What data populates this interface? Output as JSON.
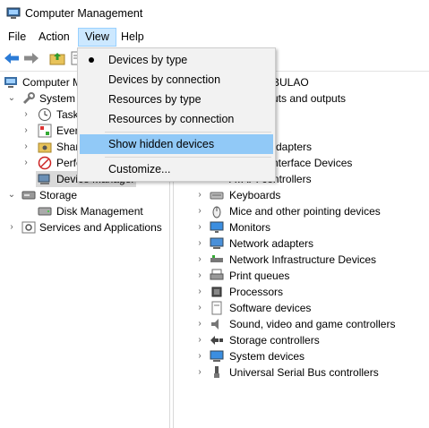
{
  "window": {
    "title": "Computer Management"
  },
  "menubar": {
    "file": "File",
    "action": "Action",
    "view": "View",
    "help": "Help"
  },
  "view_menu": {
    "items": [
      {
        "label": "Devices by type",
        "checked": true
      },
      {
        "label": "Devices by connection"
      },
      {
        "label": "Resources by type"
      },
      {
        "label": "Resources by connection"
      },
      {
        "label": "Show hidden devices",
        "highlighted": true
      },
      {
        "label": "Customize..."
      }
    ]
  },
  "left_tree": {
    "root": "Computer M",
    "system_tools": "System T",
    "task": "Task",
    "event": "Ever",
    "shared": "Shar",
    "perf": "Perfo",
    "device_manager": "Device Manager",
    "storage": "Storage",
    "disk_mgmt": "Disk Management",
    "services": "Services and Applications"
  },
  "device_tree": {
    "computer_partial": "BULAO",
    "partial_rows": [
      "uts and outputs",
      "",
      "",
      "dapters",
      "nterface Devices",
      "ATAPI controllers"
    ],
    "categories": [
      "Keyboards",
      "Mice and other pointing devices",
      "Monitors",
      "Network adapters",
      "Network Infrastructure Devices",
      "Print queues",
      "Processors",
      "Software devices",
      "Sound, video and game controllers",
      "Storage controllers",
      "System devices",
      "Universal Serial Bus controllers"
    ]
  },
  "icons": {
    "app": "computer-management-icon",
    "back": "back-arrow-icon",
    "forward": "forward-arrow-icon",
    "folder": "folder-up-icon",
    "props": "properties-icon"
  },
  "colors": {
    "menu_highlight": "#91c9f7",
    "menu_active": "#cce8ff",
    "back_arrow": "#2b7bd6"
  }
}
